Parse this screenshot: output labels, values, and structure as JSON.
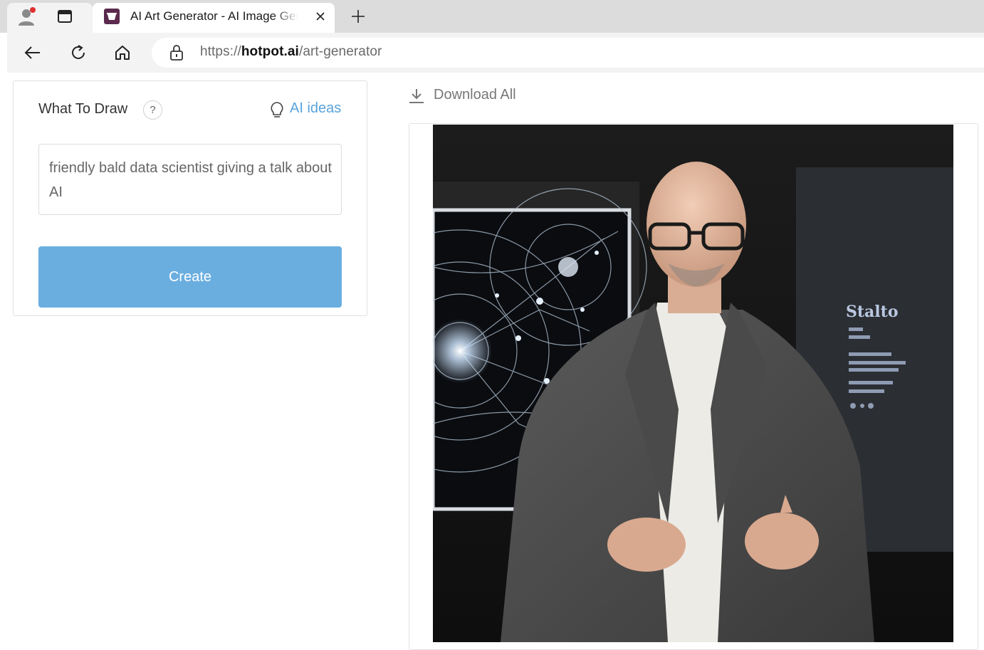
{
  "browser": {
    "tab_title": "AI Art Generator - AI Image Generator",
    "url_prefix": "https://",
    "url_domain": "hotpot.ai",
    "url_path": "/art-generator",
    "icons": {
      "profile": "profile-icon",
      "workspaces": "workspaces-icon",
      "favicon": "hotpot-favicon",
      "close": "close-icon",
      "new_tab": "plus-icon",
      "back": "back-arrow-icon",
      "refresh": "refresh-icon",
      "home": "home-icon",
      "lock": "lock-icon"
    }
  },
  "form": {
    "label": "What To Draw",
    "help_glyph": "?",
    "ai_ideas_label": "AI ideas",
    "prompt_value": "friendly bald data scientist giving a talk about AI",
    "create_label": "Create"
  },
  "results": {
    "download_all_label": "Download All",
    "slide_heading": "Stalto"
  },
  "colors": {
    "accent_link": "#5aa3db",
    "create_button": "#6aaee0",
    "tabbar_bg": "#dcdcdc",
    "toolbar_bg": "#f3f3f3"
  }
}
